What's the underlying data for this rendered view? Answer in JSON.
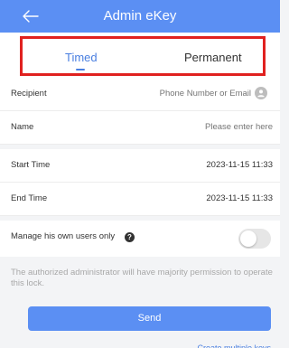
{
  "header": {
    "title": "Admin eKey",
    "bg_color": "#5b8ff3"
  },
  "tabs": [
    {
      "label": "Timed",
      "active": true
    },
    {
      "label": "Permanent",
      "active": false
    }
  ],
  "form": {
    "recipient": {
      "label": "Recipient",
      "placeholder": "Phone Number or Email"
    },
    "name": {
      "label": "Name",
      "placeholder": "Please enter here"
    },
    "start_time": {
      "label": "Start Time",
      "value": "2023-11-15 11:33"
    },
    "end_time": {
      "label": "End Time",
      "value": "2023-11-15 11:33"
    },
    "manage": {
      "label": "Manage his own users only",
      "enabled": false
    }
  },
  "note": "The authorized administrator will have majority permission to operate this lock.",
  "send_label": "Send",
  "bottom_link": "Create multiple keys",
  "accent_color": "#4a7fe0",
  "highlight_color": "#e0211f",
  "icons": [
    "back-arrow-icon",
    "contact-icon",
    "help-icon"
  ]
}
